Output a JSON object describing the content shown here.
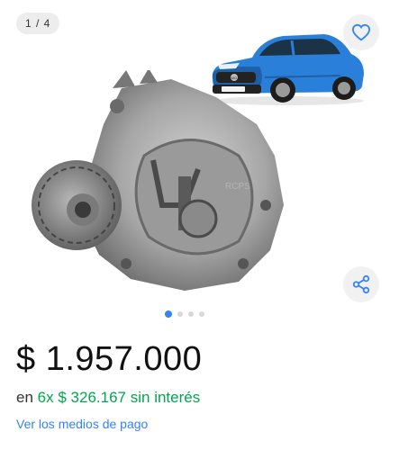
{
  "gallery": {
    "counter": "1 / 4",
    "pages": 4,
    "active_page": 1,
    "favorite_icon": "heart-icon",
    "share_icon": "share-icon",
    "watermark": "RCPS",
    "badge_text": "MG"
  },
  "colors": {
    "accent_blue": "#3483fa",
    "installment_green": "#00a650",
    "car_blue": "#2a7fd8"
  },
  "price": {
    "value": "$ 1.957.000"
  },
  "installments": {
    "prefix": "en",
    "count": "6x",
    "amount": "$ 326.167",
    "suffix": "sin interés"
  },
  "payment_link": "Ver los medios de pago"
}
